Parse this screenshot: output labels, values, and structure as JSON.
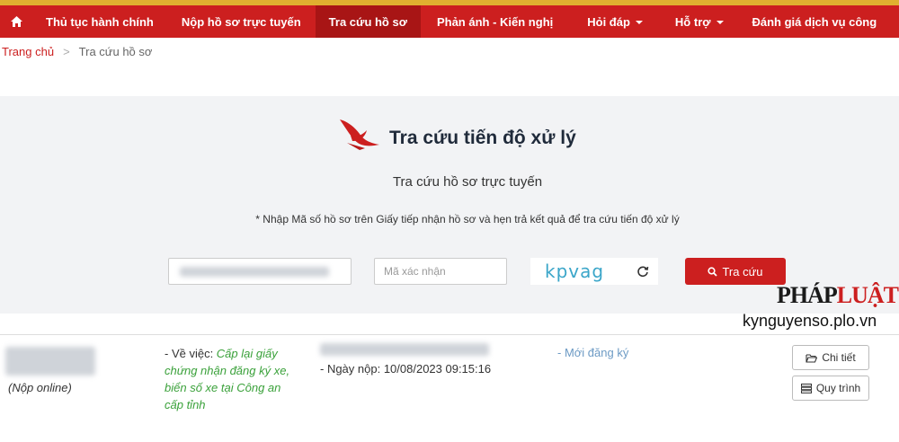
{
  "nav": {
    "items": [
      {
        "label": "Thủ tục hành chính",
        "dropdown": false,
        "active": false
      },
      {
        "label": "Nộp hồ sơ trực tuyến",
        "dropdown": false,
        "active": false
      },
      {
        "label": "Tra cứu hồ sơ",
        "dropdown": false,
        "active": true
      },
      {
        "label": "Phản ánh - Kiến nghị",
        "dropdown": false,
        "active": false
      },
      {
        "label": "Hỏi đáp",
        "dropdown": true,
        "active": false
      },
      {
        "label": "Hỗ trợ",
        "dropdown": true,
        "active": false
      },
      {
        "label": "Đánh giá dịch vụ công",
        "dropdown": false,
        "active": false
      }
    ]
  },
  "breadcrumb": {
    "home": "Trang chủ",
    "separator": ">",
    "current": "Tra cứu hồ sơ"
  },
  "search": {
    "title": "Tra cứu tiến độ xử lý",
    "subtitle": "Tra cứu hồ sơ trực tuyến",
    "note": "* Nhập Mã số hồ sơ trên Giấy tiếp nhận hồ sơ và hẹn trả kết quả để tra cứu tiến độ xử lý",
    "captcha_placeholder": "Mã xác nhận",
    "captcha_text": "kpvag",
    "button_label": "Tra cứu"
  },
  "watermark": {
    "logo_dark": "PHÁP",
    "logo_red": "LUẬT",
    "domain": "kynguyenso.plo.vn"
  },
  "result": {
    "type": "(Nộp online)",
    "subject_prefix": "- Về việc: ",
    "subject": "Cấp lại giấy chứng nhận đăng ký xe, biển số xe tại Công an cấp tỉnh",
    "submit_date": "- Ngày nộp: 10/08/2023 09:15:16",
    "status": "- Mới đăng ký",
    "detail_label": "Chi tiết",
    "process_label": "Quy trình"
  },
  "colors": {
    "brand": "#cc1f1f",
    "nav_active": "#a81515",
    "subject": "#3aa13a",
    "status": "#6c9ac4",
    "captcha": "#3ba6c9"
  }
}
